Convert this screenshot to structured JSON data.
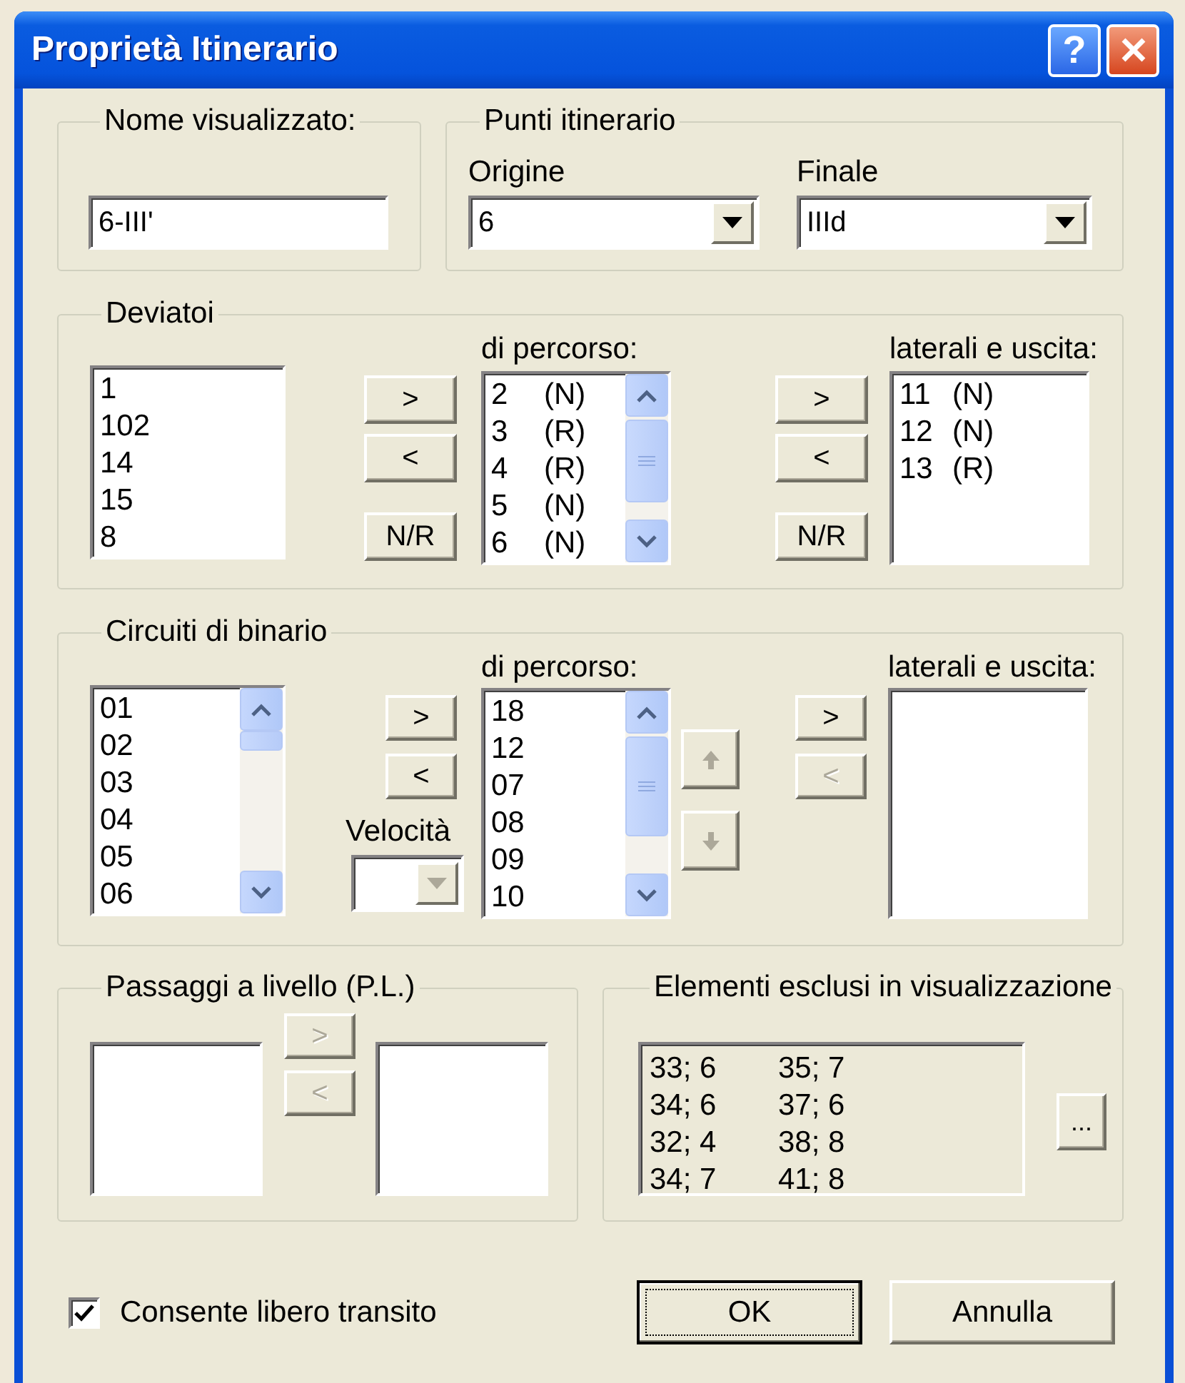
{
  "window": {
    "title": "Proprietà Itinerario",
    "help_button": "?"
  },
  "display_name": {
    "title": "Nome visualizzato:",
    "value": "6-III'"
  },
  "route_points": {
    "title": "Punti itinerario",
    "origin": {
      "label": "Origine",
      "value": "6"
    },
    "end": {
      "label": "Finale",
      "value": "IIId"
    }
  },
  "switches": {
    "title": "Deviatoi",
    "available": [
      "1",
      "102",
      "14",
      "15",
      "8"
    ],
    "buttons_path": [
      {
        "label": ">",
        "disabled": false
      },
      {
        "label": "<",
        "disabled": false
      },
      {
        "label": "N/R",
        "disabled": false
      }
    ],
    "path_label": "di percorso:",
    "path": [
      {
        "number": "2",
        "position": "(N)"
      },
      {
        "number": "3",
        "position": "(R)"
      },
      {
        "number": "4",
        "position": "(R)"
      },
      {
        "number": "5",
        "position": "(N)"
      },
      {
        "number": "6",
        "position": "(N)"
      }
    ],
    "buttons_side": [
      {
        "label": ">",
        "disabled": false
      },
      {
        "label": "<",
        "disabled": false
      },
      {
        "label": "N/R",
        "disabled": false
      }
    ],
    "side_label": "laterali e uscita:",
    "side": [
      {
        "number": "11",
        "position": "(N)"
      },
      {
        "number": "12",
        "position": "(N)"
      },
      {
        "number": "13",
        "position": "(R)"
      }
    ]
  },
  "track_circuits": {
    "title": "Circuiti di binario",
    "available": [
      "01",
      "02",
      "03",
      "04",
      "05",
      "06"
    ],
    "buttons_path": [
      {
        "label": ">",
        "disabled": false
      },
      {
        "label": "<",
        "disabled": false
      }
    ],
    "speed": {
      "label": "Velocità",
      "disabled": true
    },
    "path_label": "di percorso:",
    "path": [
      "18",
      "12",
      "07",
      "08",
      "09",
      "10"
    ],
    "order_buttons": [
      {
        "kind": "up",
        "disabled": true
      },
      {
        "kind": "down",
        "disabled": true
      }
    ],
    "buttons_side": [
      {
        "label": ">",
        "disabled": false
      },
      {
        "label": "<",
        "disabled": true
      }
    ],
    "side_label": "laterali e uscita:"
  },
  "level_crossings": {
    "title": "Passaggi a livello (P.L.)",
    "buttons": [
      {
        "label": ">",
        "disabled": true
      },
      {
        "label": "<",
        "disabled": true
      }
    ]
  },
  "excluded": {
    "title": "Elementi esclusi in visualizzazione",
    "disabled": true,
    "items": [
      "33; 6",
      "35; 7",
      "34; 6",
      "37; 6",
      "32; 4",
      "38; 8",
      "34; 7",
      "41; 8"
    ],
    "more_button": "..."
  },
  "free_transit": {
    "label": "Consente libero transito",
    "checked": true
  },
  "buttons": [
    {
      "label": "OK",
      "default": true
    },
    {
      "label": "Annulla",
      "default": false
    }
  ]
}
